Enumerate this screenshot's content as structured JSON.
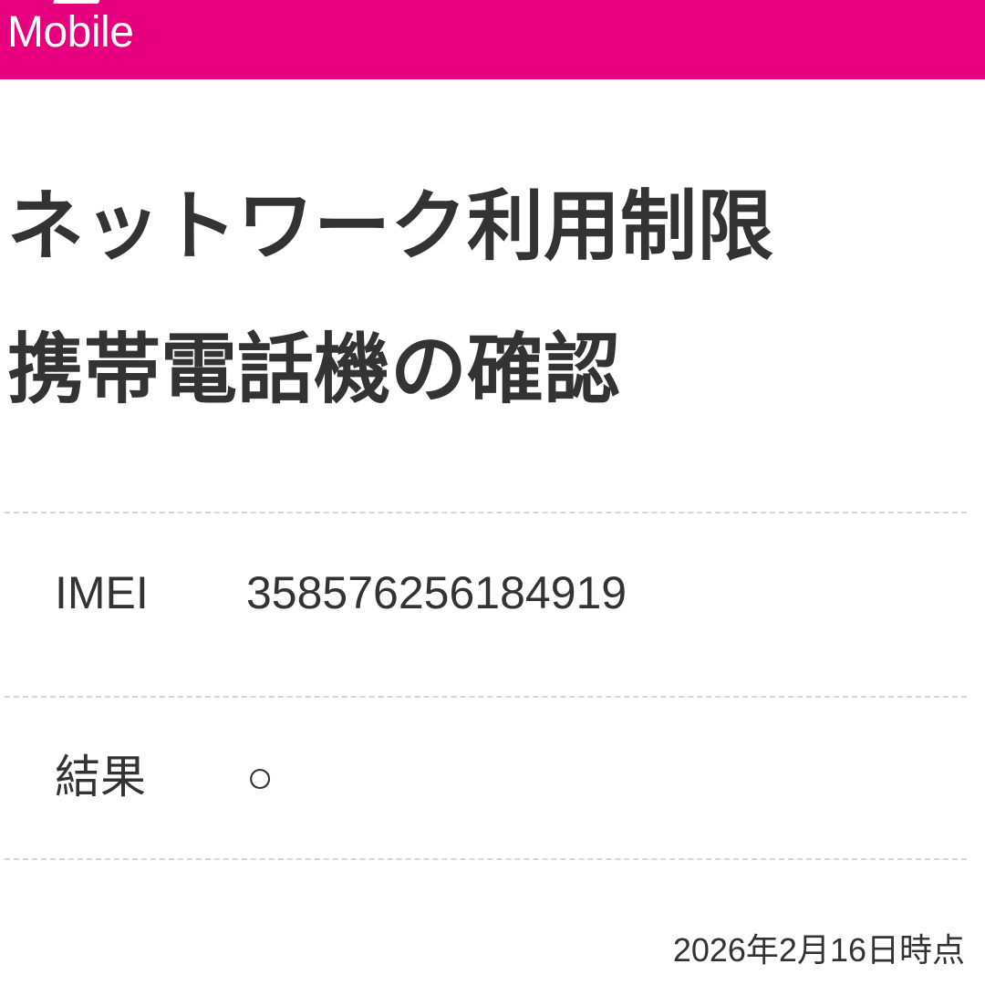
{
  "header": {
    "brand": "Mobile",
    "color": "#e6007e"
  },
  "title": {
    "line1": "ネットワーク利用制限",
    "line2": "携帯電話機の確認"
  },
  "rows": [
    {
      "label": "IMEI",
      "value": "358576256184919"
    },
    {
      "label": "結果",
      "value": "○"
    }
  ],
  "timestamp": "2026年2月16日時点"
}
